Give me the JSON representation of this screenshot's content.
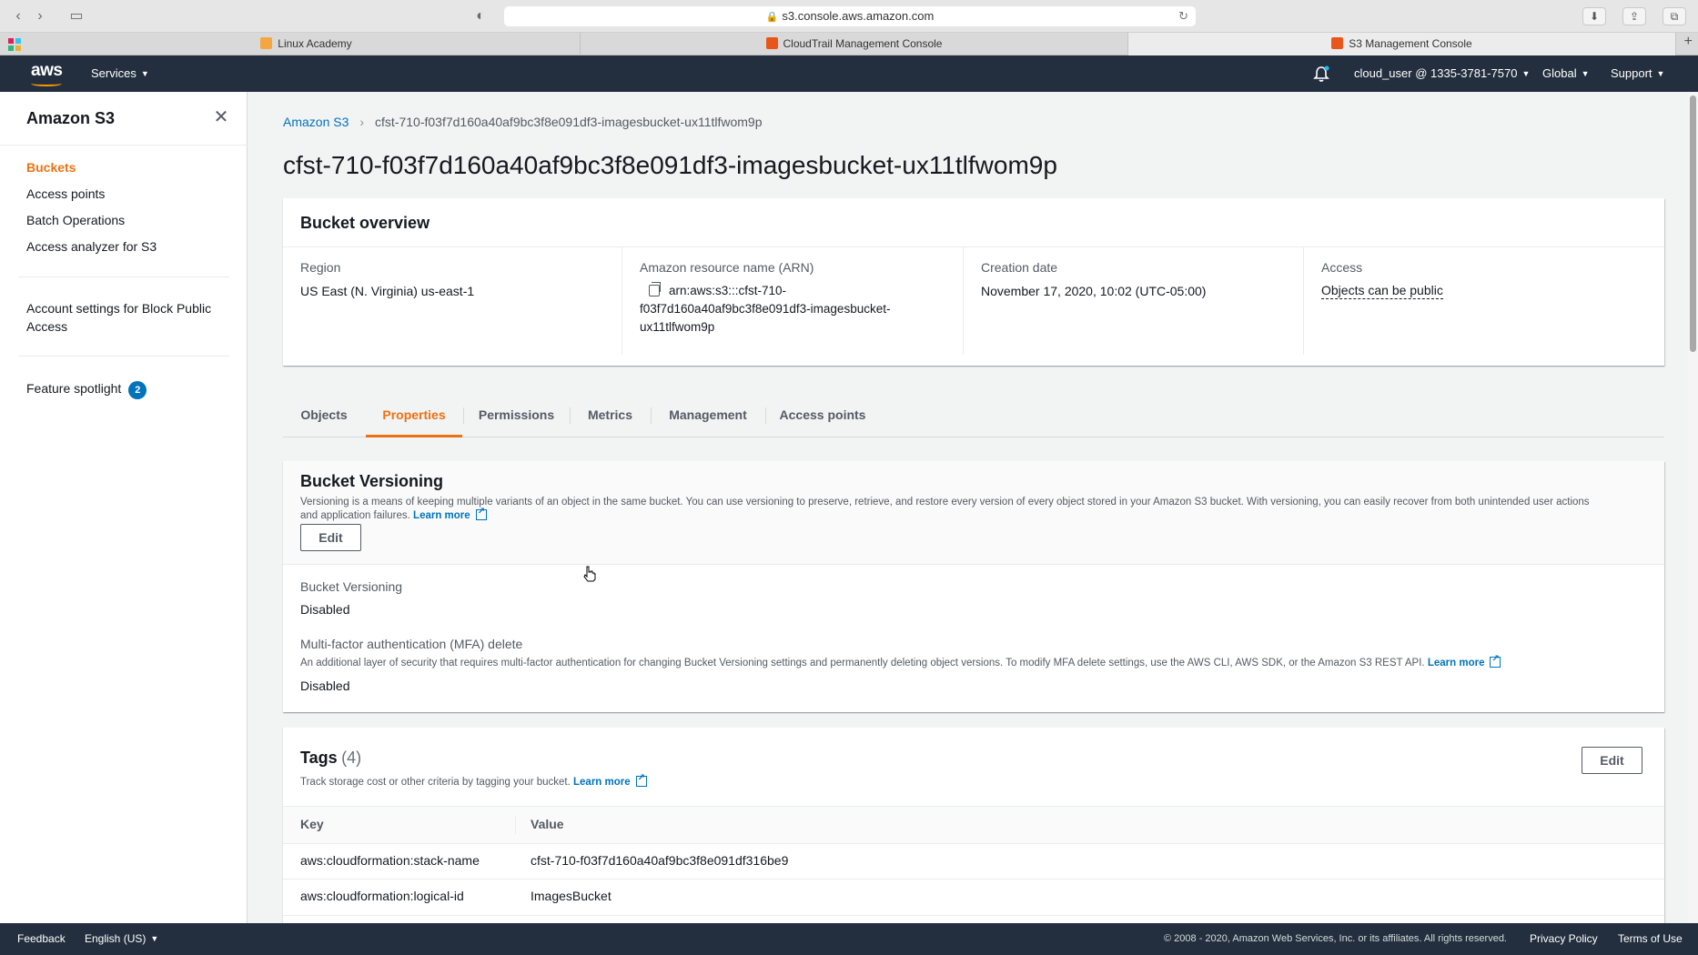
{
  "browser": {
    "url": "s3.console.aws.amazon.com",
    "tabs": [
      {
        "label": "Linux Academy",
        "active": false
      },
      {
        "label": "CloudTrail Management Console",
        "active": false
      },
      {
        "label": "S3 Management Console",
        "active": true
      }
    ]
  },
  "topnav": {
    "logo": "aws",
    "services_label": "Services",
    "account_label": "cloud_user @ 1335-3781-7570",
    "region_label": "Global",
    "support_label": "Support"
  },
  "sidebar": {
    "title": "Amazon S3",
    "items": [
      {
        "label": "Buckets",
        "active": true
      },
      {
        "label": "Access points",
        "active": false
      },
      {
        "label": "Batch Operations",
        "active": false
      },
      {
        "label": "Access analyzer for S3",
        "active": false
      }
    ],
    "account_settings_label": "Account settings for Block Public Access",
    "feature_spotlight_label": "Feature spotlight",
    "feature_spotlight_count": "2"
  },
  "breadcrumb": {
    "root": "Amazon S3",
    "current": "cfst-710-f03f7d160a40af9bc3f8e091df3-imagesbucket-ux11tlfwom9p"
  },
  "page_title": "cfst-710-f03f7d160a40af9bc3f8e091df3-imagesbucket-ux11tlfwom9p",
  "overview": {
    "title": "Bucket overview",
    "region_label": "Region",
    "region_value": "US East (N. Virginia) us-east-1",
    "arn_label": "Amazon resource name (ARN)",
    "arn_line1": "arn:aws:s3:::cfst-710-",
    "arn_line2": "f03f7d160a40af9bc3f8e091df3-imagesbucket-",
    "arn_line3": "ux11tlfwom9p",
    "creation_label": "Creation date",
    "creation_value": "November 17, 2020, 10:02 (UTC-05:00)",
    "access_label": "Access",
    "access_value": "Objects can be public"
  },
  "tabs": [
    {
      "label": "Objects",
      "active": false
    },
    {
      "label": "Properties",
      "active": true
    },
    {
      "label": "Permissions",
      "active": false
    },
    {
      "label": "Metrics",
      "active": false
    },
    {
      "label": "Management",
      "active": false
    },
    {
      "label": "Access points",
      "active": false
    }
  ],
  "versioning": {
    "title": "Bucket Versioning",
    "description_line1": "Versioning is a means of keeping multiple variants of an object in the same bucket. You can use versioning to preserve, retrieve, and restore every version of every object stored in your Amazon S3 bucket. With versioning, you can easily recover from both unintended user actions",
    "description_line2": "and application failures.",
    "learn_more": "Learn more",
    "edit_label": "Edit",
    "status_label": "Bucket Versioning",
    "status_value": "Disabled",
    "mfa_label": "Multi-factor authentication (MFA) delete",
    "mfa_description": "An additional layer of security that requires multi-factor authentication for changing Bucket Versioning settings and permanently deleting object versions. To modify MFA delete settings, use the AWS CLI, AWS SDK, or the Amazon S3 REST API.",
    "mfa_learn_more": "Learn more",
    "mfa_value": "Disabled"
  },
  "tags": {
    "title": "Tags",
    "count": "(4)",
    "description": "Track storage cost or other criteria by tagging your bucket.",
    "learn_more": "Learn more",
    "edit_label": "Edit",
    "columns": [
      "Key",
      "Value"
    ],
    "rows": [
      {
        "key": "aws:cloudformation:stack-name",
        "value": "cfst-710-f03f7d160a40af9bc3f8e091df316be9"
      },
      {
        "key": "aws:cloudformation:logical-id",
        "value": "ImagesBucket"
      }
    ]
  },
  "footer": {
    "feedback": "Feedback",
    "language": "English (US)",
    "copyright": "© 2008 - 2020, Amazon Web Services, Inc. or its affiliates. All rights reserved.",
    "privacy": "Privacy Policy",
    "terms": "Terms of Use"
  },
  "colors": {
    "accent": "#ec7211",
    "link": "#0073bb",
    "nav_bg": "#232f3e"
  }
}
